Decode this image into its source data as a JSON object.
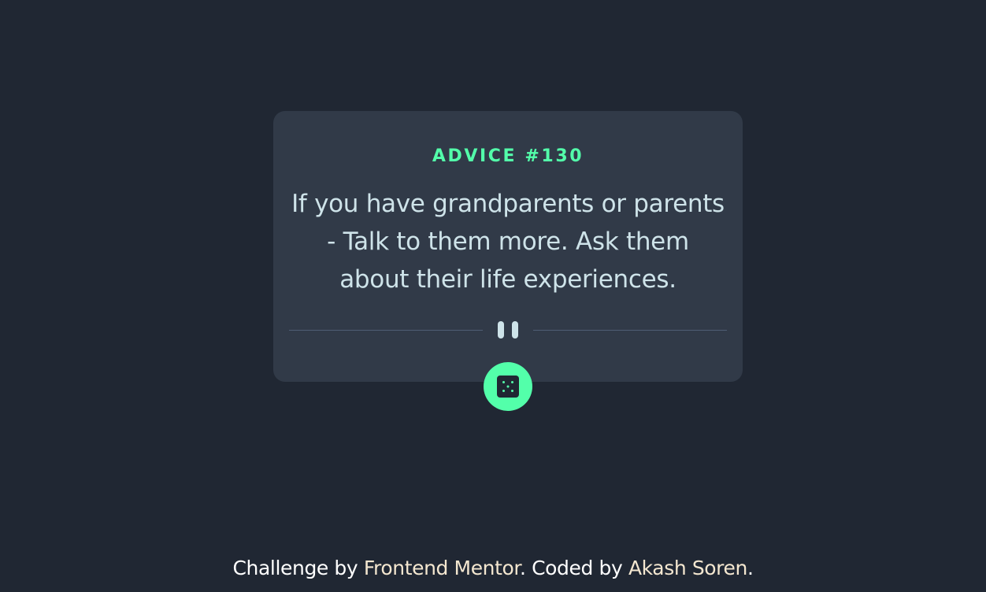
{
  "card": {
    "advice_label": "ADVICE #130",
    "advice_text": "If you have grandparents or parents - Talk to them more. Ask them about their life experiences."
  },
  "divider": {
    "icon": "pause-icon"
  },
  "dice_button": {
    "icon": "dice-icon"
  },
  "footer": {
    "prefix": "Challenge by ",
    "link_mentor": "Frontend Mentor",
    "middle": ". Coded by ",
    "link_author": "Akash Soren",
    "suffix": "."
  },
  "colors": {
    "background": "#202733",
    "card": "#313a48",
    "accent": "#53ffaa",
    "text": "#cee3e9",
    "divider": "#4f5d74",
    "footer_link": "#f4e7d0"
  }
}
